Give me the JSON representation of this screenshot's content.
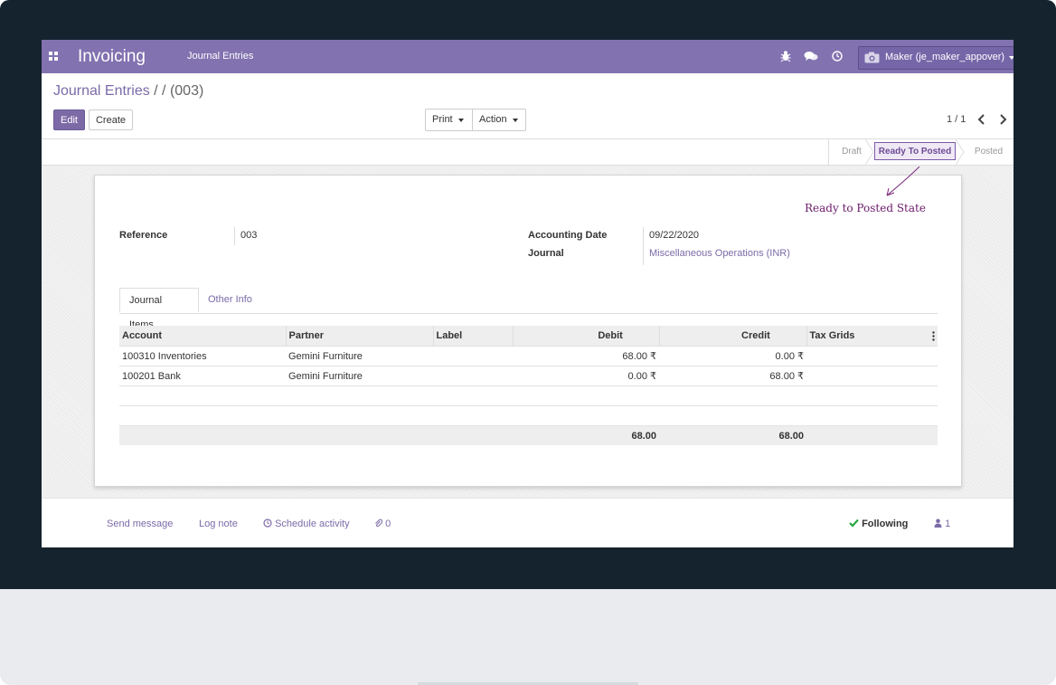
{
  "navbar": {
    "app_title": "Invoicing",
    "menu_item": "Journal Entries",
    "user_name": "Maker (je_maker_appover)",
    "accent_color": "#8272b0",
    "icons": [
      "apps-icon",
      "bug-icon",
      "chat-icon",
      "clock-icon",
      "camera-icon"
    ]
  },
  "breadcrumb": {
    "parent": "Journal Entries",
    "separator": " / / ",
    "current": "(003)"
  },
  "toolbar": {
    "edit_label": "Edit",
    "create_label": "Create",
    "print_label": "Print",
    "action_label": "Action"
  },
  "pager": {
    "value": "1 / 1"
  },
  "statusbar": {
    "stages": [
      "Draft",
      "Ready To Posted",
      "Posted"
    ],
    "active": "Ready To Posted"
  },
  "annotation": {
    "text": "Ready to Posted State"
  },
  "form": {
    "reference_label": "Reference",
    "reference_value": "003",
    "accounting_date_label": "Accounting Date",
    "accounting_date_value": "09/22/2020",
    "journal_label": "Journal",
    "journal_value": "Miscellaneous Operations (INR)"
  },
  "tabs": [
    "Journal Items",
    "Other Info"
  ],
  "items_table": {
    "columns": [
      "Account",
      "Partner",
      "Label",
      "Debit",
      "Credit",
      "Tax Grids"
    ],
    "rows": [
      {
        "account": "100310 Inventories",
        "partner": "Gemini Furniture",
        "label": "",
        "debit": "68.00 ₹",
        "credit": "0.00 ₹",
        "tax_grids": ""
      },
      {
        "account": "100201 Bank",
        "partner": "Gemini Furniture",
        "label": "",
        "debit": "0.00 ₹",
        "credit": "68.00 ₹",
        "tax_grids": ""
      }
    ],
    "totals": {
      "debit": "68.00",
      "credit": "68.00"
    }
  },
  "chatter": {
    "send_message": "Send message",
    "log_note": "Log note",
    "schedule_activity": "Schedule activity",
    "attachments": "0",
    "following": "Following",
    "followers": "1"
  }
}
